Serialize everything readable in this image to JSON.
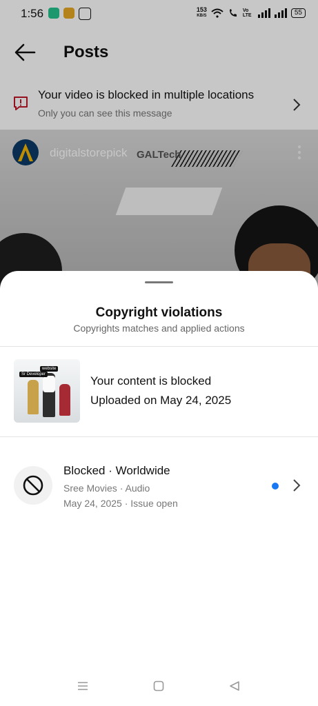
{
  "status_bar": {
    "time": "1:56",
    "net_speed_value": "153",
    "net_speed_unit": "KB/S",
    "volte_label": "Vo LTE",
    "battery": "55"
  },
  "header": {
    "title": "Posts"
  },
  "alert": {
    "title": "Your video is blocked in multiple locations",
    "subtitle": "Only you can see this message"
  },
  "post": {
    "author": "digitalstorepick",
    "watermark": "GALTech"
  },
  "sheet": {
    "title": "Copyright violations",
    "subtitle": "Copyrights matches and applied actions",
    "content": {
      "status": "Your content is blocked",
      "uploaded": "Uploaded on May 24, 2025",
      "thumb_tag_1": "Sr Developer",
      "thumb_tag_2": "website"
    },
    "violation": {
      "title": "Blocked · Worldwide",
      "source": "Sree Movies · Audio",
      "date_status": "May 24, 2025 · Issue open"
    }
  },
  "colors": {
    "accent_blue": "#1877f2",
    "alert_red": "#c0172a"
  },
  "icons": {
    "back": "back-arrow-icon",
    "alert": "alert-icon",
    "ban": "blocked-icon",
    "chevron": "chevron-right-icon"
  }
}
